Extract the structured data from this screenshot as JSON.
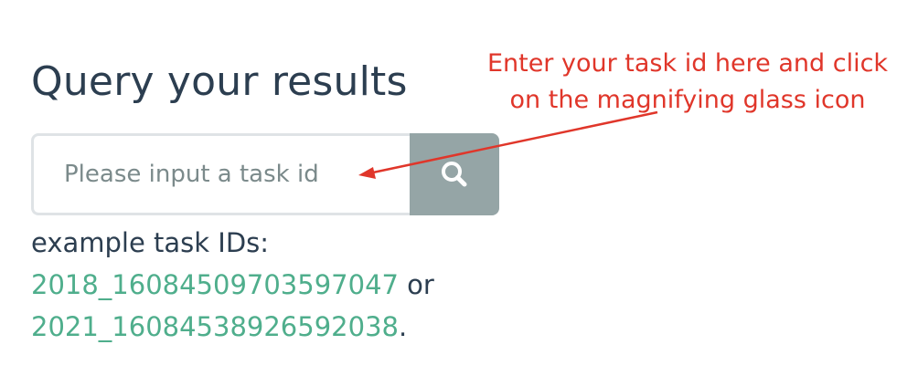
{
  "heading": "Query your results",
  "search": {
    "placeholder": "Please input a task id",
    "value": "",
    "button_icon": "search-icon"
  },
  "examples": {
    "label": "example task IDs:",
    "ids": [
      "2018_16084509703597047",
      "2021_16084538926592038"
    ],
    "connector": " or",
    "terminator": "."
  },
  "annotation": {
    "line1": "Enter your task id here and click",
    "line2": "on the magnifying glass icon"
  },
  "colors": {
    "heading": "#2c3e50",
    "link": "#4fae8c",
    "button": "#95a5a6",
    "annotation": "#e0362a"
  }
}
